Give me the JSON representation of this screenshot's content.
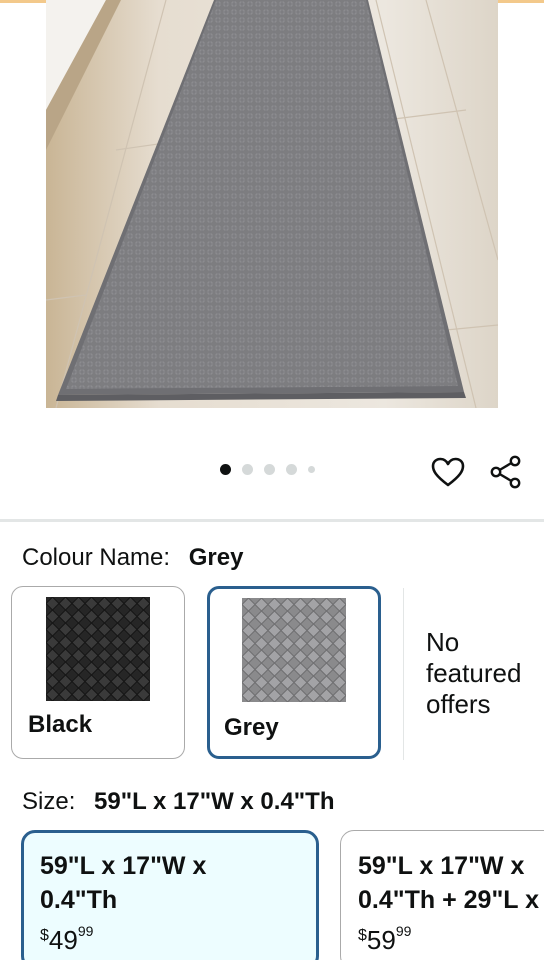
{
  "product": {
    "image_alt": "Grey woven runner rug on light wooden floor",
    "carousel": {
      "total": 5,
      "active": 0
    }
  },
  "actions": {
    "wishlist_icon": "heart-icon",
    "share_icon": "share-icon"
  },
  "colour": {
    "label": "Colour Name:",
    "selected": "Grey",
    "options": [
      {
        "name": "Black",
        "color": "#2b2b2b"
      },
      {
        "name": "Grey",
        "color": "#8f8f90"
      }
    ],
    "no_offers_text": "No featured offers"
  },
  "size": {
    "label": "Size:",
    "selected": "59\"L x 17\"W x 0.4\"Th",
    "options": [
      {
        "line1": "59\"L x 17\"W x",
        "line2": "0.4\"Th",
        "currency": "$",
        "whole": "49",
        "fraction": "99"
      },
      {
        "line1": "59\"L x 17\"W x",
        "line2": "0.4\"Th + 29\"L x",
        "currency": "$",
        "whole": "59",
        "fraction": "99"
      }
    ]
  },
  "colors": {
    "accent_border": "#2a5f8e",
    "selected_bg": "#edfdff",
    "divider": "#e3e6e6"
  }
}
